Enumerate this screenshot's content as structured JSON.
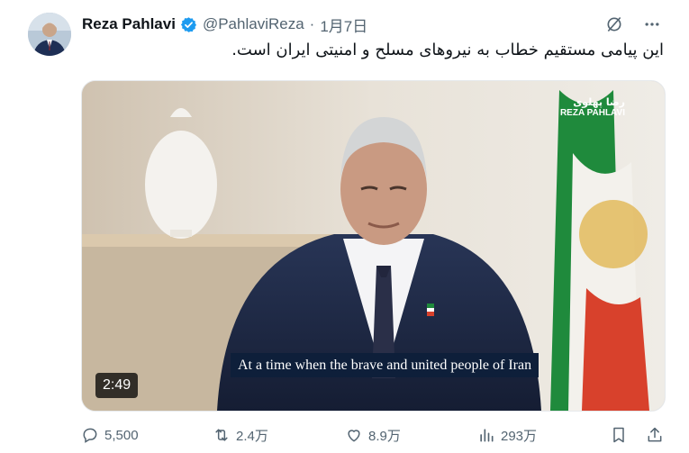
{
  "author": {
    "name": "Reza Pahlavi",
    "handle": "@PahlaviReza",
    "separator": "·",
    "date": "1月7日"
  },
  "tweet": {
    "text": "این پیامی مستقیم خطاب به نیروهای مسلح و امنیتی ایران است."
  },
  "video": {
    "subtitle": "At a time when the brave and united people of Iran",
    "duration": "2:49",
    "watermark_script": "رضا پهلوی",
    "watermark_latin": "REZA PAHLAVI"
  },
  "actions": {
    "replies": "5,500",
    "reposts": "2.4万",
    "likes": "8.9万",
    "views": "293万"
  },
  "colors": {
    "verified": "#1d9bf0",
    "text_secondary": "#536471",
    "subtitle_bg": "#0e1f3a"
  },
  "icons": [
    "grok-icon",
    "more-icon",
    "verified-badge-icon",
    "reply-icon",
    "repost-icon",
    "like-icon",
    "views-icon",
    "bookmark-icon",
    "share-icon"
  ]
}
